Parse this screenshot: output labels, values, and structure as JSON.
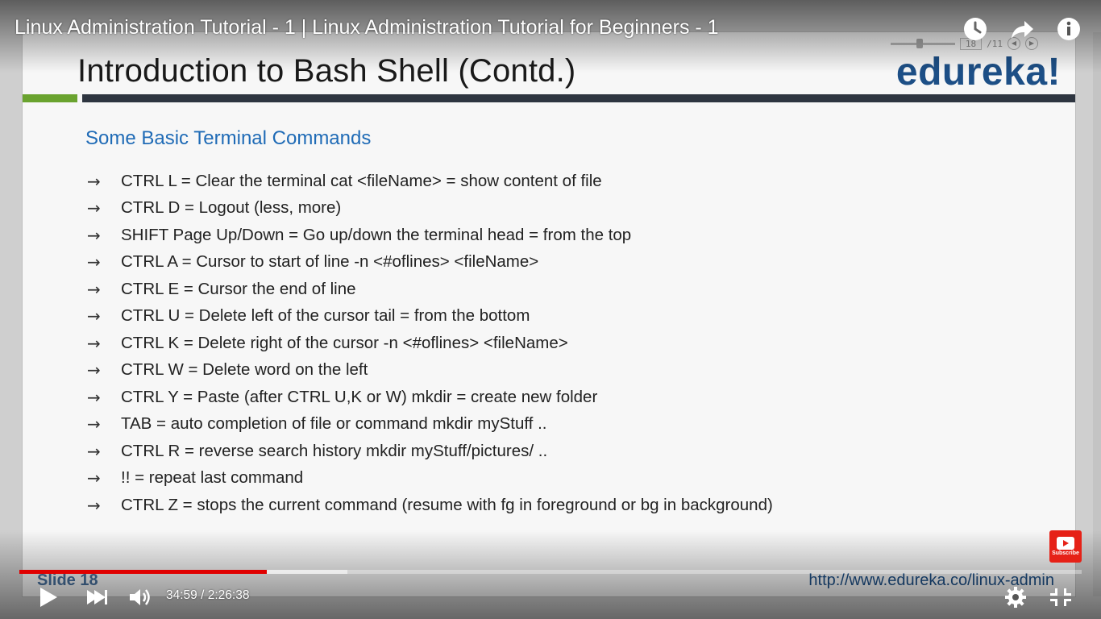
{
  "video": {
    "title": "Linux Administration Tutorial - 1 | Linux Administration Tutorial for Beginners - 1",
    "current_time": "34:59",
    "separator": "/",
    "duration": "2:26:38",
    "progress_fraction": 0.233,
    "buffer_fraction": 0.309,
    "colors": {
      "progress": "#e00000",
      "subscribe": "#e62117"
    }
  },
  "overlay": {
    "icons": [
      "watch-later-icon",
      "share-icon",
      "info-icon"
    ],
    "controls": [
      "play-icon",
      "next-icon",
      "volume-icon",
      "settings-icon",
      "fullscreen-icon"
    ],
    "subscribe_label": "Subscribe"
  },
  "viewer": {
    "page_current": "18",
    "page_total": "/11"
  },
  "slide": {
    "title": "Introduction to Bash Shell (Contd.)",
    "logo": "edureka!",
    "heading": "Some Basic Terminal Commands",
    "arrow": "→",
    "items": [
      "CTRL L = Clear the terminal cat <fileName> = show content of file",
      "CTRL D = Logout (less, more)",
      "SHIFT Page Up/Down = Go up/down the terminal head = from the top",
      "CTRL A = Cursor to start of line -n <#oflines> <fileName>",
      "CTRL E = Cursor the end of line",
      "CTRL U = Delete left of the cursor tail = from the bottom",
      "CTRL K = Delete right of the cursor -n <#oflines> <fileName>",
      "CTRL W = Delete word on the left",
      "CTRL Y = Paste (after CTRL U,K or W) mkdir = create new folder",
      "TAB = auto completion of file or command mkdir myStuff ..",
      "CTRL R = reverse search history mkdir myStuff/pictures/ ..",
      "!! = repeat last command",
      "CTRL Z = stops the current command (resume with fg in foreground or bg in background)"
    ],
    "footer_left": "Slide 18",
    "footer_url": "http://www.edureka.co/linux-admin"
  }
}
